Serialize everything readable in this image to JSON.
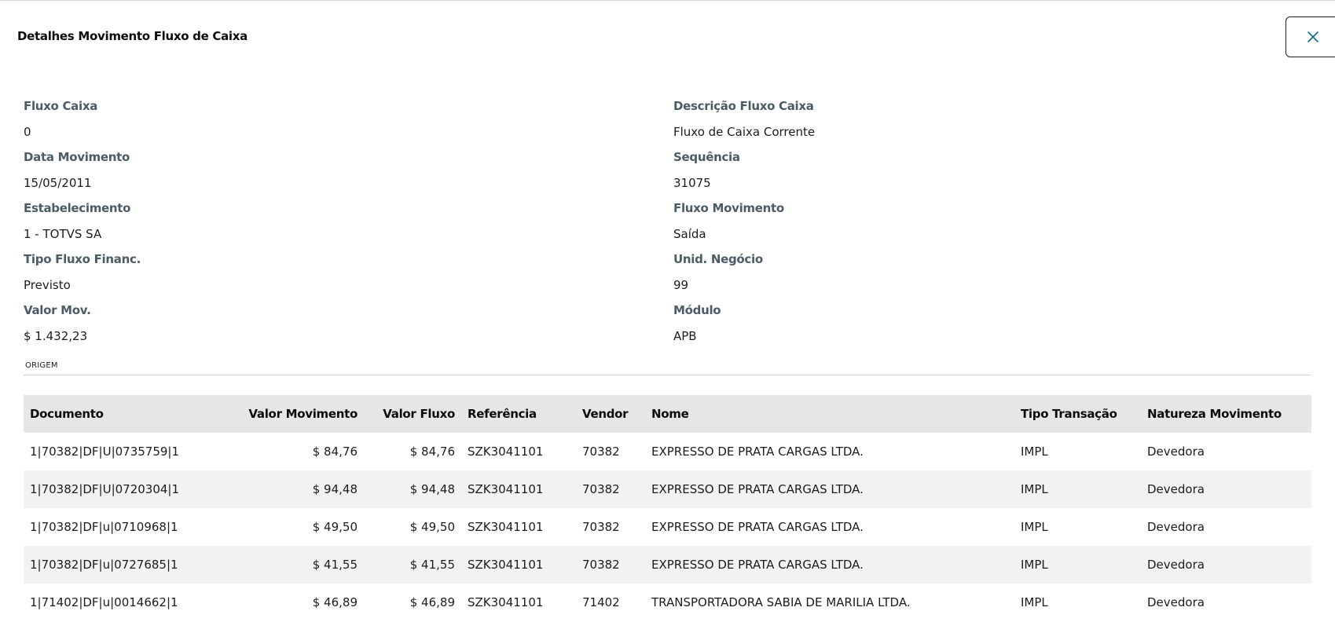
{
  "modal": {
    "title": "Detalhes Movimento Fluxo de Caixa"
  },
  "fields": {
    "left": [
      {
        "label": "Fluxo Caixa",
        "value": "0"
      },
      {
        "label": "Data Movimento",
        "value": "15/05/2011"
      },
      {
        "label": "Estabelecimento",
        "value": "1 - TOTVS SA"
      },
      {
        "label": "Tipo Fluxo Financ.",
        "value": "Previsto"
      },
      {
        "label": "Valor Mov.",
        "value": "$ 1.432,23"
      }
    ],
    "right": [
      {
        "label": "Descrição Fluxo Caixa",
        "value": "Fluxo de Caixa Corrente"
      },
      {
        "label": "Sequência",
        "value": "31075"
      },
      {
        "label": "Fluxo Movimento",
        "value": "Saída"
      },
      {
        "label": "Unid. Negócio",
        "value": "99"
      },
      {
        "label": "Módulo",
        "value": "APB"
      }
    ]
  },
  "origem": {
    "section_label": "ORIGEM",
    "columns": [
      "Documento",
      "Valor Movimento",
      "Valor Fluxo",
      "Referência",
      "Vendor",
      "Nome",
      "Tipo Transação",
      "Natureza Movimento"
    ],
    "rows": [
      [
        "1|70382|DF|U|0735759|1",
        "$ 84,76",
        "$ 84,76",
        "SZK3041101",
        "70382",
        "EXPRESSO DE PRATA CARGAS LTDA.",
        "IMPL",
        "Devedora"
      ],
      [
        "1|70382|DF|U|0720304|1",
        "$ 94,48",
        "$ 94,48",
        "SZK3041101",
        "70382",
        "EXPRESSO DE PRATA CARGAS LTDA.",
        "IMPL",
        "Devedora"
      ],
      [
        "1|70382|DF|u|0710968|1",
        "$ 49,50",
        "$ 49,50",
        "SZK3041101",
        "70382",
        "EXPRESSO DE PRATA CARGAS LTDA.",
        "IMPL",
        "Devedora"
      ],
      [
        "1|70382|DF|u|0727685|1",
        "$ 41,55",
        "$ 41,55",
        "SZK3041101",
        "70382",
        "EXPRESSO DE PRATA CARGAS LTDA.",
        "IMPL",
        "Devedora"
      ],
      [
        "1|71402|DF|u|0014662|1",
        "$ 46,89",
        "$ 46,89",
        "SZK3041101",
        "71402",
        "TRANSPORTADORA SABIA DE MARILIA LTDA.",
        "IMPL",
        "Devedora"
      ]
    ]
  },
  "icons": {
    "close": "close-icon"
  },
  "colors": {
    "label": "#4a5c66",
    "close_icon": "#0c6b8c",
    "header_bg": "#e6e6e6",
    "stripe_bg": "#f2f2f2"
  }
}
